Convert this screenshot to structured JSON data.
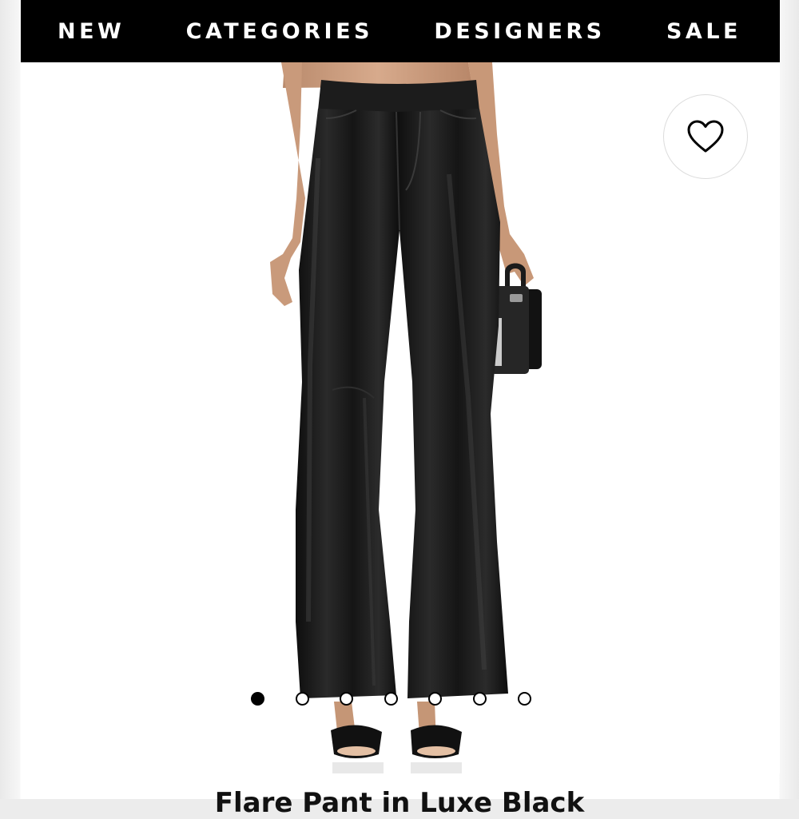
{
  "nav": {
    "items": [
      {
        "label": "NEW"
      },
      {
        "label": "CATEGORIES"
      },
      {
        "label": "DESIGNERS"
      },
      {
        "label": "SALE"
      }
    ]
  },
  "product": {
    "image_icon": "product-photo",
    "wishlist_icon": "heart-icon",
    "title": "Flare Pant in Luxe Black"
  },
  "carousel": {
    "total": 7,
    "active_index": 0
  },
  "colors": {
    "nav_bg": "#000000",
    "nav_text": "#ffffff",
    "garment": "#1a1a1a"
  }
}
